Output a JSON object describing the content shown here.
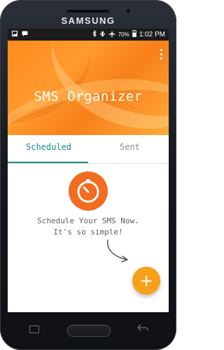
{
  "device": {
    "brand": "SAMSUNG"
  },
  "status_bar": {
    "battery_percent": "70%",
    "time": "1:02 PM"
  },
  "header": {
    "title": "SMS Organizer"
  },
  "tabs": [
    {
      "label": "Scheduled",
      "active": true
    },
    {
      "label": "Sent",
      "active": false
    }
  ],
  "empty_state": {
    "line1": "Schedule Your SMS Now.",
    "line2": "It's so simple!"
  },
  "fab": {
    "symbol": "+"
  },
  "colors": {
    "accent": "#1b8a84",
    "header_orange": "#ff8a1f",
    "fab_orange": "#f7a11a",
    "timer_orange": "#f26c21"
  },
  "icons": [
    "gallery-icon",
    "message-icon",
    "bluetooth-icon",
    "vibrate-icon",
    "airplane-mode-icon",
    "battery-icon",
    "more-options-icon",
    "timer-icon",
    "curved-arrow-icon",
    "add-icon",
    "recent-apps-icon",
    "home-button",
    "back-icon"
  ]
}
